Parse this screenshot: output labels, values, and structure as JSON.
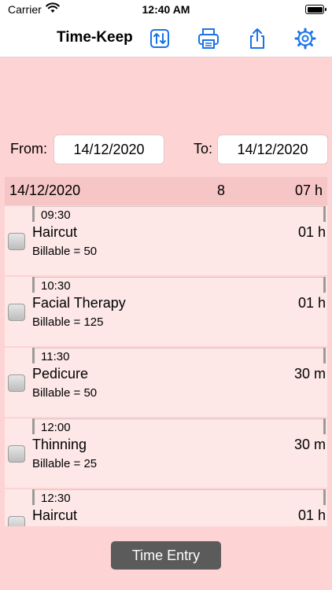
{
  "status_bar": {
    "carrier": "Carrier",
    "time": "12:40 AM"
  },
  "navbar": {
    "title": "Time-Keep",
    "icons": [
      "sort-arrows-icon",
      "printer-icon",
      "share-icon",
      "gear-icon"
    ],
    "accent_color": "#1a73e8"
  },
  "filter": {
    "from_label": "From:",
    "from_value": "14/12/2020",
    "to_label": "To:",
    "to_value": "14/12/2020"
  },
  "section": {
    "date": "14/12/2020",
    "count": "8",
    "total": "07 h"
  },
  "entries": [
    {
      "time": "09:30",
      "name": "Haircut",
      "duration": "01 h",
      "billable": "Billable = 50"
    },
    {
      "time": "10:30",
      "name": "Facial Therapy",
      "duration": "01 h",
      "billable": "Billable = 125"
    },
    {
      "time": "11:30",
      "name": "Pedicure",
      "duration": "30 m",
      "billable": "Billable = 50"
    },
    {
      "time": "12:00",
      "name": "Thinning",
      "duration": "30 m",
      "billable": "Billable = 25"
    },
    {
      "time": "12:30",
      "name": "Haircut",
      "duration": "01 h",
      "billable": ""
    }
  ],
  "button": {
    "time_entry_label": "Time Entry"
  },
  "colors": {
    "background": "#fed3d3",
    "row": "#fde7e7",
    "section": "#f6c5c5",
    "button": "#5b5b5b"
  }
}
